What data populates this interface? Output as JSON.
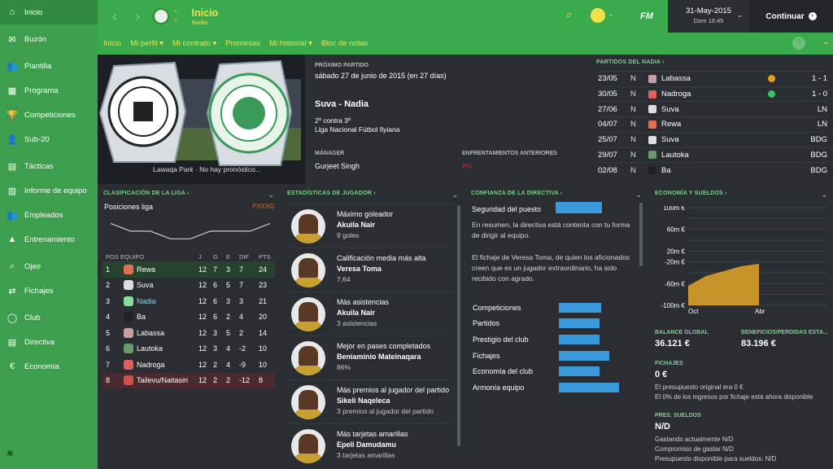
{
  "sidebar": {
    "items": [
      {
        "label": "Inicio",
        "icon": "home-icon",
        "glyph": "⌂"
      },
      {
        "label": "Buzón",
        "icon": "inbox-icon",
        "glyph": "✉"
      },
      {
        "label": "Plantilla",
        "icon": "squad-icon",
        "glyph": "👥"
      },
      {
        "label": "Programa",
        "icon": "calendar-icon",
        "glyph": "▦"
      },
      {
        "label": "Competiciones",
        "icon": "trophy-icon",
        "glyph": "🏆"
      },
      {
        "label": "Sub-20",
        "icon": "youth-icon",
        "glyph": "👤"
      },
      {
        "label": "Tácticas",
        "icon": "tactics-icon",
        "glyph": "▤"
      },
      {
        "label": "Informe de equipo",
        "icon": "report-icon",
        "glyph": "▥"
      },
      {
        "label": "Empleados",
        "icon": "staff-icon",
        "glyph": "👥"
      },
      {
        "label": "Entrenamiento",
        "icon": "training-icon",
        "glyph": "▲"
      },
      {
        "label": "Ojeo",
        "icon": "scouting-icon",
        "glyph": "⌕"
      },
      {
        "label": "Fichajes",
        "icon": "transfers-icon",
        "glyph": "⇄"
      },
      {
        "label": "Club",
        "icon": "club-icon",
        "glyph": "◯"
      },
      {
        "label": "Directiva",
        "icon": "board-icon",
        "glyph": "▤"
      },
      {
        "label": "Economía",
        "icon": "finances-icon",
        "glyph": "€"
      }
    ]
  },
  "header": {
    "title": "Inicio",
    "subtitle": "Nadia",
    "fm_label": "FM",
    "date": "31-May-2015",
    "time": "Dom 16:45",
    "continue_label": "Continuar"
  },
  "subnav": {
    "items": [
      "Inicio",
      "Mi perfil ▾",
      "Mi contrato ▾",
      "Promesas",
      "Mi historial ▾",
      "Bloc de notas"
    ],
    "help": "?"
  },
  "next_match": {
    "label": "PRÓXIMO PARTIDO",
    "date": "sábado 27 de junio de 2015 (en 27 días)",
    "fixture": "Suva - Nadia",
    "position": "2º contra 3º",
    "competition": "Liga Nacional Fútbol fiyiana",
    "venue": "Lawaqa Park · No hay pronóstico...",
    "manager_label": "MÁNAGER",
    "manager": "Gurjeet Singh",
    "h2h_label": "ENFRENTAMIENTOS ANTERIORES",
    "h2h_value": "PG"
  },
  "matches": {
    "header": "PARTIDOS DEL NADIA ›",
    "rows": [
      {
        "date": "23/05",
        "venue": "N",
        "opp": "Labassa",
        "res": "1 - 1",
        "dot": "#e0a020",
        "crest": "#c9a0a0"
      },
      {
        "date": "30/05",
        "venue": "N",
        "opp": "Nadroga",
        "res": "1 - 0",
        "dot": "#3ac46a",
        "crest": "#e06060"
      },
      {
        "date": "27/06",
        "venue": "N",
        "opp": "Suva",
        "res": "LN",
        "dot": "",
        "crest": "#dddddd"
      },
      {
        "date": "04/07",
        "venue": "N",
        "opp": "Rewa",
        "res": "LN",
        "dot": "",
        "crest": "#e07050"
      },
      {
        "date": "25/07",
        "venue": "N",
        "opp": "Suva",
        "res": "BDG",
        "dot": "",
        "crest": "#dddddd"
      },
      {
        "date": "29/07",
        "venue": "N",
        "opp": "Lautoka",
        "res": "BDG",
        "dot": "",
        "crest": "#6a9a6a"
      },
      {
        "date": "02/08",
        "venue": "N",
        "opp": "Ba",
        "res": "BDG",
        "dot": "",
        "crest": "#222222"
      }
    ]
  },
  "league": {
    "header": "CLASIFICACIÓN DE LA LIGA ›",
    "positions_label": "Posiciones liga",
    "form": "PXXXG",
    "form_chart": [
      2,
      3,
      3,
      4,
      4,
      3,
      3,
      3,
      2
    ],
    "cols": [
      "POS",
      "EQUIPO",
      "J",
      "G",
      "E",
      "DIF",
      "PTS"
    ],
    "rows": [
      {
        "pos": "1",
        "team": "Rewa",
        "j": "12",
        "g": "7",
        "e": "3",
        "dif": "7",
        "pts": "24",
        "hl": "green",
        "crest": "#e07050"
      },
      {
        "pos": "2",
        "team": "Suva",
        "j": "12",
        "g": "6",
        "e": "5",
        "dif": "7",
        "pts": "23",
        "hl": "",
        "crest": "#dddddd"
      },
      {
        "pos": "3",
        "team": "Nadia",
        "j": "12",
        "g": "6",
        "e": "3",
        "dif": "3",
        "pts": "21",
        "hl": "self",
        "crest": "#88dd99"
      },
      {
        "pos": "4",
        "team": "Ba",
        "j": "12",
        "g": "6",
        "e": "2",
        "dif": "4",
        "pts": "20",
        "hl": "",
        "crest": "#222222"
      },
      {
        "pos": "5",
        "team": "Labassa",
        "j": "12",
        "g": "3",
        "e": "5",
        "dif": "2",
        "pts": "14",
        "hl": "",
        "crest": "#c9a0a0"
      },
      {
        "pos": "6",
        "team": "Lautoka",
        "j": "12",
        "g": "3",
        "e": "4",
        "dif": "-2",
        "pts": "10",
        "hl": "",
        "crest": "#6a9a6a"
      },
      {
        "pos": "7",
        "team": "Nadroga",
        "j": "12",
        "g": "2",
        "e": "4",
        "dif": "-9",
        "pts": "10",
        "hl": "",
        "crest": "#e06060"
      },
      {
        "pos": "8",
        "team": "Tailevu/Naitasiri",
        "j": "12",
        "g": "2",
        "e": "2",
        "dif": "-12",
        "pts": "8",
        "hl": "red",
        "crest": "#d05050"
      }
    ]
  },
  "player_stats": {
    "header": "ESTADÍSTICAS DE JUGADOR ›",
    "items": [
      {
        "label": "Máximo goleador",
        "player": "Akuila Nair",
        "value": "9 goles",
        "icon": "goals-icon"
      },
      {
        "label": "Calificación media más alta",
        "player": "Veresa Toma",
        "value": "7,64",
        "icon": "rating-icon"
      },
      {
        "label": "Más asistencias",
        "player": "Akuila Nair",
        "value": "3 asistencias",
        "icon": "assists-icon"
      },
      {
        "label": "Mejor en pases completados",
        "player": "Beniaminio Mateinaqara",
        "value": "86%",
        "icon": "passes-icon"
      },
      {
        "label": "Más premios al jugador del partido",
        "player": "Sikeli Naqeleca",
        "value": "3 premios al jugador del partido",
        "icon": "award-icon"
      },
      {
        "label": "Más tarjetas amarillas",
        "player": "Epeli Damudamu",
        "value": "3 tarjetas amarillas",
        "icon": "yellow-card-icon"
      }
    ]
  },
  "board": {
    "header": "CONFIANZA DE LA DIRECTIVA ›",
    "job_security_label": "Seguridad del puesto",
    "job_security": 0.5,
    "text1": "En resumen, la directiva está contenta con tu forma de dirigir al equipo.",
    "text2": "El fichaje de Veresa Toma, de quien los aficionados creen que es un jugador extraordinario, ha sido recibido con agrado.",
    "bars": [
      {
        "label": "Competiciones",
        "value": 0.52
      },
      {
        "label": "Partidos",
        "value": 0.5
      },
      {
        "label": "Prestigio del club",
        "value": 0.5
      },
      {
        "label": "Fichajes",
        "value": 0.62
      },
      {
        "label": "Economía del club",
        "value": 0.5
      },
      {
        "label": "Armonía equipo",
        "value": 0.74
      }
    ]
  },
  "finances": {
    "header": "ECONOMÍA Y SUELDOS ›",
    "chart_data": {
      "type": "area",
      "y_ticks": [
        "100m €",
        "80m €",
        "60m €",
        "40m €",
        "20m €",
        "-20m €",
        "-40m €",
        "-60m €",
        "-80m €",
        "-100m €"
      ],
      "x_labels": [
        "Oct",
        "Abr"
      ],
      "ylim": [
        -100,
        100
      ],
      "values": [
        -60,
        -40,
        -30,
        -20,
        -15
      ],
      "color": "#c8942a"
    },
    "balance_label": "BALANCE GLOBAL",
    "balance": "36.121 €",
    "profit_label": "BENEFICIOS/PÉRDIDAS ESTA...",
    "profit": "83.196 €",
    "transfers_label": "FICHAJES",
    "transfers_value": "0 €",
    "transfers_text1": "El presupuesto original era 0 €",
    "transfers_text2": "El 0% de los ingresos por fichaje está ahora disponible",
    "wages_label": "PRES. SUELDOS",
    "wages_value": "N/D",
    "wages_text1": "Gastando actualmente N/D",
    "wages_text2": "Compromiso de gastar N/D",
    "wages_text3": "Presupuesto disponible para sueldos: N/D"
  }
}
